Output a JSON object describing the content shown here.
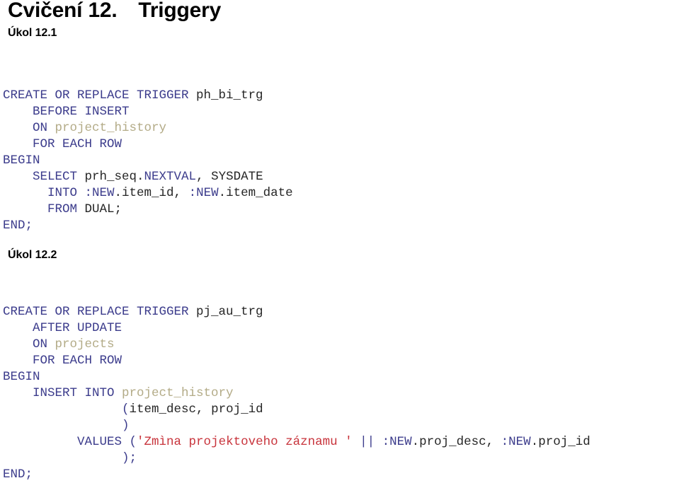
{
  "document": {
    "title": "Cvičení 12. Triggery",
    "background_color": "#ffffff",
    "syntax_colors": {
      "keyword": "#3c3c8c",
      "table": "#b3ab87",
      "string": "#c8343c",
      "identifier": "#262626",
      "heading": "#000000"
    }
  },
  "sections": [
    {
      "heading": "Úkol 12.1",
      "code_lines": [
        [
          {
            "t": "CREATE OR REPLACE TRIGGER ",
            "c": "kw"
          },
          {
            "t": "ph_bi_trg",
            "c": "id"
          }
        ],
        [
          {
            "t": "    BEFORE INSERT",
            "c": "kw"
          }
        ],
        [
          {
            "t": "    ON ",
            "c": "kw"
          },
          {
            "t": "project_history",
            "c": "tbl"
          }
        ],
        [
          {
            "t": "    FOR EACH ROW",
            "c": "kw"
          }
        ],
        [
          {
            "t": "BEGIN",
            "c": "kw"
          }
        ],
        [
          {
            "t": "    SELECT ",
            "c": "kw"
          },
          {
            "t": "prh_seq.",
            "c": "id"
          },
          {
            "t": "NEXTVAL",
            "c": "kw"
          },
          {
            "t": ", SYSDATE",
            "c": "id"
          }
        ],
        [
          {
            "t": "      INTO ",
            "c": "kw"
          },
          {
            "t": ":NEW",
            "c": "kw"
          },
          {
            "t": ".item_id, ",
            "c": "id"
          },
          {
            "t": ":NEW",
            "c": "kw"
          },
          {
            "t": ".item_date",
            "c": "id"
          }
        ],
        [
          {
            "t": "      FROM ",
            "c": "kw"
          },
          {
            "t": "DUAL;",
            "c": "id"
          }
        ],
        [
          {
            "t": "END;",
            "c": "kw"
          }
        ]
      ]
    },
    {
      "heading": "Úkol 12.2",
      "code_lines": [
        [
          {
            "t": "CREATE OR REPLACE TRIGGER ",
            "c": "kw"
          },
          {
            "t": "pj_au_trg",
            "c": "id"
          }
        ],
        [
          {
            "t": "    AFTER UPDATE",
            "c": "kw"
          }
        ],
        [
          {
            "t": "    ON ",
            "c": "kw"
          },
          {
            "t": "projects",
            "c": "tbl"
          }
        ],
        [
          {
            "t": "    FOR EACH ROW",
            "c": "kw"
          }
        ],
        [
          {
            "t": "BEGIN",
            "c": "kw"
          }
        ],
        [
          {
            "t": "    INSERT INTO ",
            "c": "kw"
          },
          {
            "t": "project_history",
            "c": "tbl"
          }
        ],
        [
          {
            "t": "                ",
            "c": "id"
          },
          {
            "t": "(",
            "c": "op"
          },
          {
            "t": "item_desc, proj_id",
            "c": "id"
          }
        ],
        [
          {
            "t": "                ",
            "c": "id"
          },
          {
            "t": ")",
            "c": "op"
          }
        ],
        [
          {
            "t": "          VALUES ",
            "c": "kw"
          },
          {
            "t": "(",
            "c": "op"
          },
          {
            "t": "'Zmìna projektoveho záznamu '",
            "c": "str"
          },
          {
            "t": " || ",
            "c": "op"
          },
          {
            "t": ":NEW",
            "c": "kw"
          },
          {
            "t": ".proj_desc, ",
            "c": "id"
          },
          {
            "t": ":NEW",
            "c": "kw"
          },
          {
            "t": ".proj_id",
            "c": "id"
          }
        ],
        [
          {
            "t": "                ",
            "c": "id"
          },
          {
            "t": ");",
            "c": "op"
          }
        ],
        [
          {
            "t": "END;",
            "c": "kw"
          }
        ]
      ]
    }
  ]
}
